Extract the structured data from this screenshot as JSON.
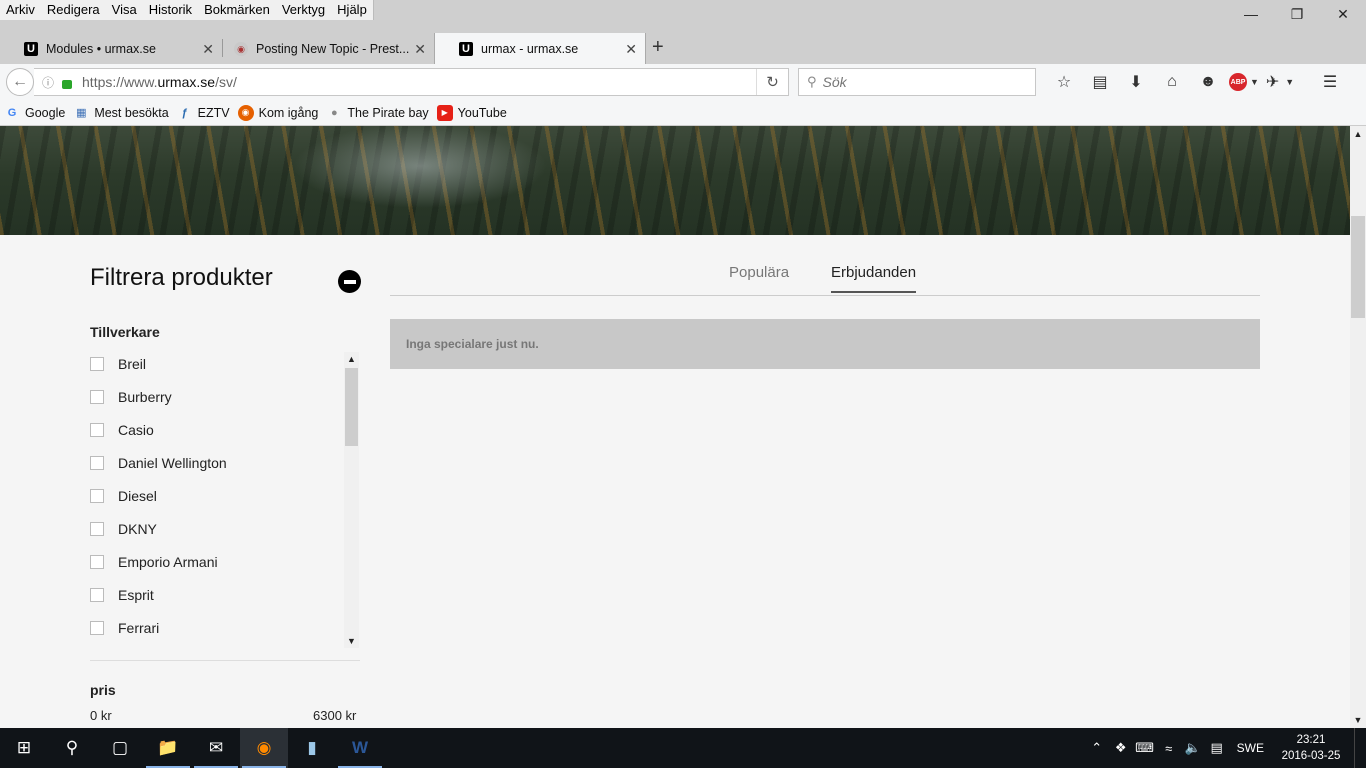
{
  "menu": [
    "Arkiv",
    "Redigera",
    "Visa",
    "Historik",
    "Bokmärken",
    "Verktyg",
    "Hjälp"
  ],
  "tabs": [
    {
      "label": "Modules • urmax.se",
      "icon": "urmax-logo-icon"
    },
    {
      "label": "Posting New Topic - Prest...",
      "icon": "prestashop-icon"
    },
    {
      "label": "urmax - urmax.se",
      "icon": "urmax-logo-icon"
    }
  ],
  "url": {
    "prefix": "https://www.",
    "domain": "urmax.se",
    "path": "/sv/"
  },
  "search": {
    "placeholder": "Sök"
  },
  "bookmarks": [
    {
      "label": "Google",
      "icon": "google-icon"
    },
    {
      "label": "Mest besökta",
      "icon": "most-visited-icon"
    },
    {
      "label": "EZTV",
      "icon": "eztv-icon"
    },
    {
      "label": "Kom igång",
      "icon": "firefox-icon"
    },
    {
      "label": "The Pirate bay",
      "icon": "globe-icon"
    },
    {
      "label": "YouTube",
      "icon": "youtube-icon"
    }
  ],
  "filter": {
    "title": "Filtrera produkter",
    "manufacturer_label": "Tillverkare",
    "brands": [
      "Breil",
      "Burberry",
      "Casio",
      "Daniel Wellington",
      "Diesel",
      "DKNY",
      "Emporio Armani",
      "Esprit",
      "Ferrari"
    ],
    "price_label": "pris",
    "price_min": "0 kr",
    "price_max": "6300 kr"
  },
  "product_tabs": {
    "popular": "Populära",
    "offers": "Erbjudanden"
  },
  "notice": "Inga specialare just nu.",
  "tray": {
    "lang": "SWE",
    "time": "23:21",
    "date": "2016-03-25"
  },
  "colors": {
    "accent_dark": "#000000",
    "notice_bg": "#c8c8c8",
    "taskbar": "#101418"
  }
}
